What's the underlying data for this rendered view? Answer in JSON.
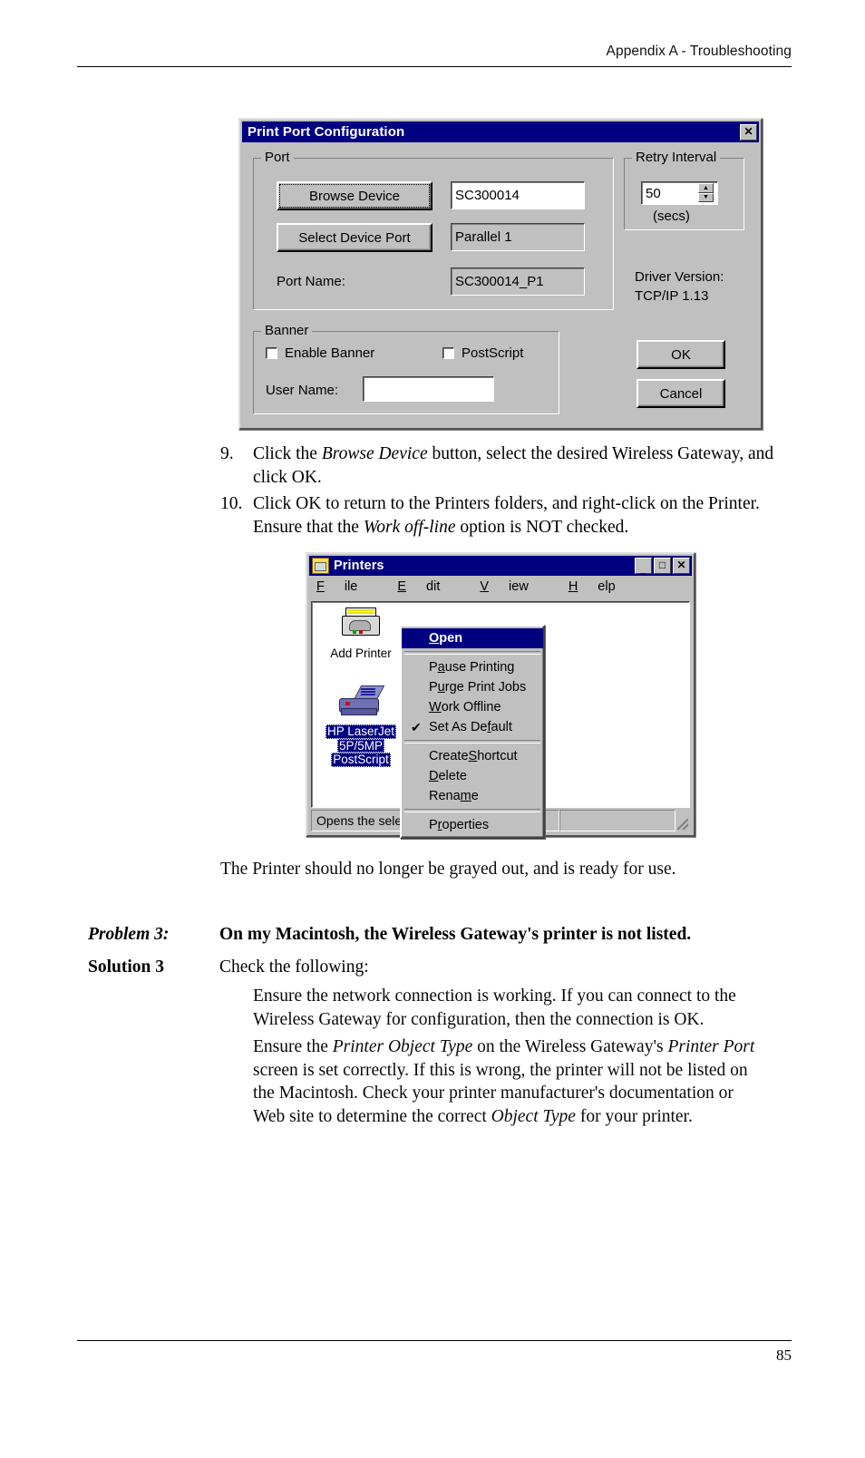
{
  "page": {
    "header": "Appendix A - Troubleshooting",
    "page_number": "85"
  },
  "print_port_dialog": {
    "title": "Print Port Configuration",
    "close_button": "✕",
    "port_group": {
      "legend": "Port",
      "browse_device_button": "Browse Device",
      "device_name_value": "SC300014",
      "select_device_port_button": "Select Device Port",
      "device_port_value": "Parallel 1",
      "port_name_label": "Port Name:",
      "port_name_value": "SC300014_P1"
    },
    "retry_group": {
      "legend": "Retry Interval",
      "value": "50",
      "units_label": "(secs)",
      "spin_up": "▲",
      "spin_down": "▼"
    },
    "driver_version_line1": "Driver Version:",
    "driver_version_line2": "TCP/IP  1.13",
    "banner_group": {
      "legend": "Banner",
      "enable_banner_label": "Enable Banner",
      "postscript_label": "PostScript",
      "user_name_label": "User Name:",
      "user_name_value": ""
    },
    "ok_button": "OK",
    "cancel_button": "Cancel"
  },
  "steps": [
    {
      "number": "9.",
      "line1_a": "Click the ",
      "line1_em": "Browse Device",
      "line1_b": " button, select the desired Wireless Gateway,",
      "line2": "and click OK."
    },
    {
      "number": "10.",
      "line1": "Click OK to return to the Printers folders, and right-click on the",
      "line2_a": "Printer. Ensure that the ",
      "line2_em": "Work off-line",
      "line2_b": " option is NOT checked."
    }
  ],
  "printers_window": {
    "title": "Printers",
    "minimize_button": "_",
    "maximize_button": "□",
    "close_button": "✕",
    "menus": [
      {
        "pre": "",
        "hot": "F",
        "post": "ile"
      },
      {
        "pre": "",
        "hot": "E",
        "post": "dit"
      },
      {
        "pre": "",
        "hot": "V",
        "post": "iew"
      },
      {
        "pre": "",
        "hot": "H",
        "post": "elp"
      }
    ],
    "icons": [
      {
        "caption": "Add Printer",
        "selected": false
      },
      {
        "caption_lines": [
          "HP LaserJet",
          "5P/5MP",
          "PostScript"
        ],
        "selected": true
      }
    ],
    "context_menu": [
      {
        "pre": "",
        "hot": "O",
        "post": "pen",
        "bold": true,
        "selected": true,
        "checked": false
      },
      {
        "separator": true
      },
      {
        "pre": "P",
        "hot": "a",
        "post": "use Printing",
        "bold": false,
        "selected": false,
        "checked": false
      },
      {
        "pre": "P",
        "hot": "u",
        "post": "rge Print Jobs",
        "bold": false,
        "selected": false,
        "checked": false
      },
      {
        "pre": "",
        "hot": "W",
        "post": "ork Offline",
        "bold": false,
        "selected": false,
        "checked": false
      },
      {
        "pre": "Set As De",
        "hot": "f",
        "post": "ault",
        "bold": false,
        "selected": false,
        "checked": true
      },
      {
        "separator": true
      },
      {
        "pre": "Create ",
        "hot": "S",
        "post": "hortcut",
        "bold": false,
        "selected": false,
        "checked": false
      },
      {
        "pre": "",
        "hot": "D",
        "post": "elete",
        "bold": false,
        "selected": false,
        "checked": false
      },
      {
        "pre": "Rena",
        "hot": "m",
        "post": "e",
        "bold": false,
        "selected": false,
        "checked": false
      },
      {
        "separator": true
      },
      {
        "pre": "P",
        "hot": "r",
        "post": "operties",
        "bold": false,
        "selected": false,
        "checked": false
      }
    ],
    "status_text": "Opens the sele",
    "status_panel2": ""
  },
  "after_figure_text": "The Printer should no longer be grayed out, and is ready for use.",
  "problem3": {
    "label": "Problem 3:",
    "statement": "On my Macintosh, the Wireless Gateway's printer is not listed."
  },
  "solution3": {
    "label": "Solution 3",
    "intro": "Check the following:",
    "bullet1": "Ensure the network connection is working. If you can connect to the Wireless Gateway for configuration, then the connection is OK.",
    "bullet2": {
      "a": "Ensure the ",
      "em1": "Printer Object Type",
      "b": " on the Wireless Gateway's ",
      "em2": "Printer Port",
      "c": " screen is set correctly. If this is wrong, the printer will not be listed on the Macintosh. Check your printer manufacturer's documentation or Web site to determine the correct ",
      "em3": "Object Type",
      "d": " for your printer."
    }
  },
  "colors": {
    "titlebar": "#000080",
    "face": "#c0c0c0",
    "selection": "#000080"
  }
}
